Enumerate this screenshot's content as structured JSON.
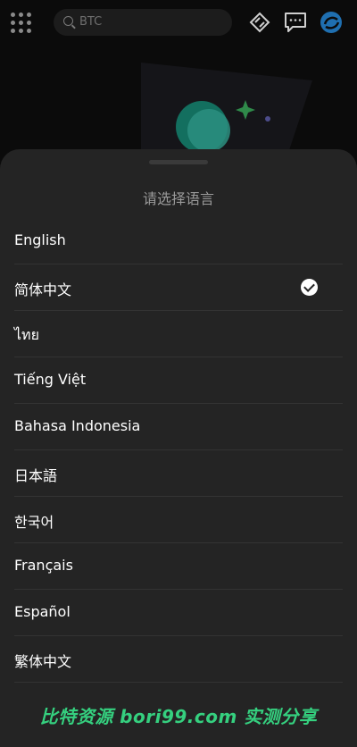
{
  "search": {
    "placeholder": "BTC"
  },
  "sheet": {
    "title": "请选择语言",
    "languages": [
      {
        "label": "English",
        "selected": false
      },
      {
        "label": "简体中文",
        "selected": true
      },
      {
        "label": "ไทย",
        "selected": false
      },
      {
        "label": "Tiếng Việt",
        "selected": false
      },
      {
        "label": "Bahasa Indonesia",
        "selected": false
      },
      {
        "label": "日本語",
        "selected": false
      },
      {
        "label": "한국어",
        "selected": false
      },
      {
        "label": "Français",
        "selected": false
      },
      {
        "label": "Español",
        "selected": false
      },
      {
        "label": "繁体中文",
        "selected": false
      }
    ]
  },
  "watermark": "比特资源 bori99.com 实测分享",
  "colors": {
    "accent": "#35d07f",
    "sheet_bg": "#242424",
    "page_bg": "#0b0b0b"
  },
  "icons": [
    "apps-grid-icon",
    "search-icon",
    "gift-icon",
    "message-icon",
    "avatar-icon",
    "checkmark-icon"
  ]
}
